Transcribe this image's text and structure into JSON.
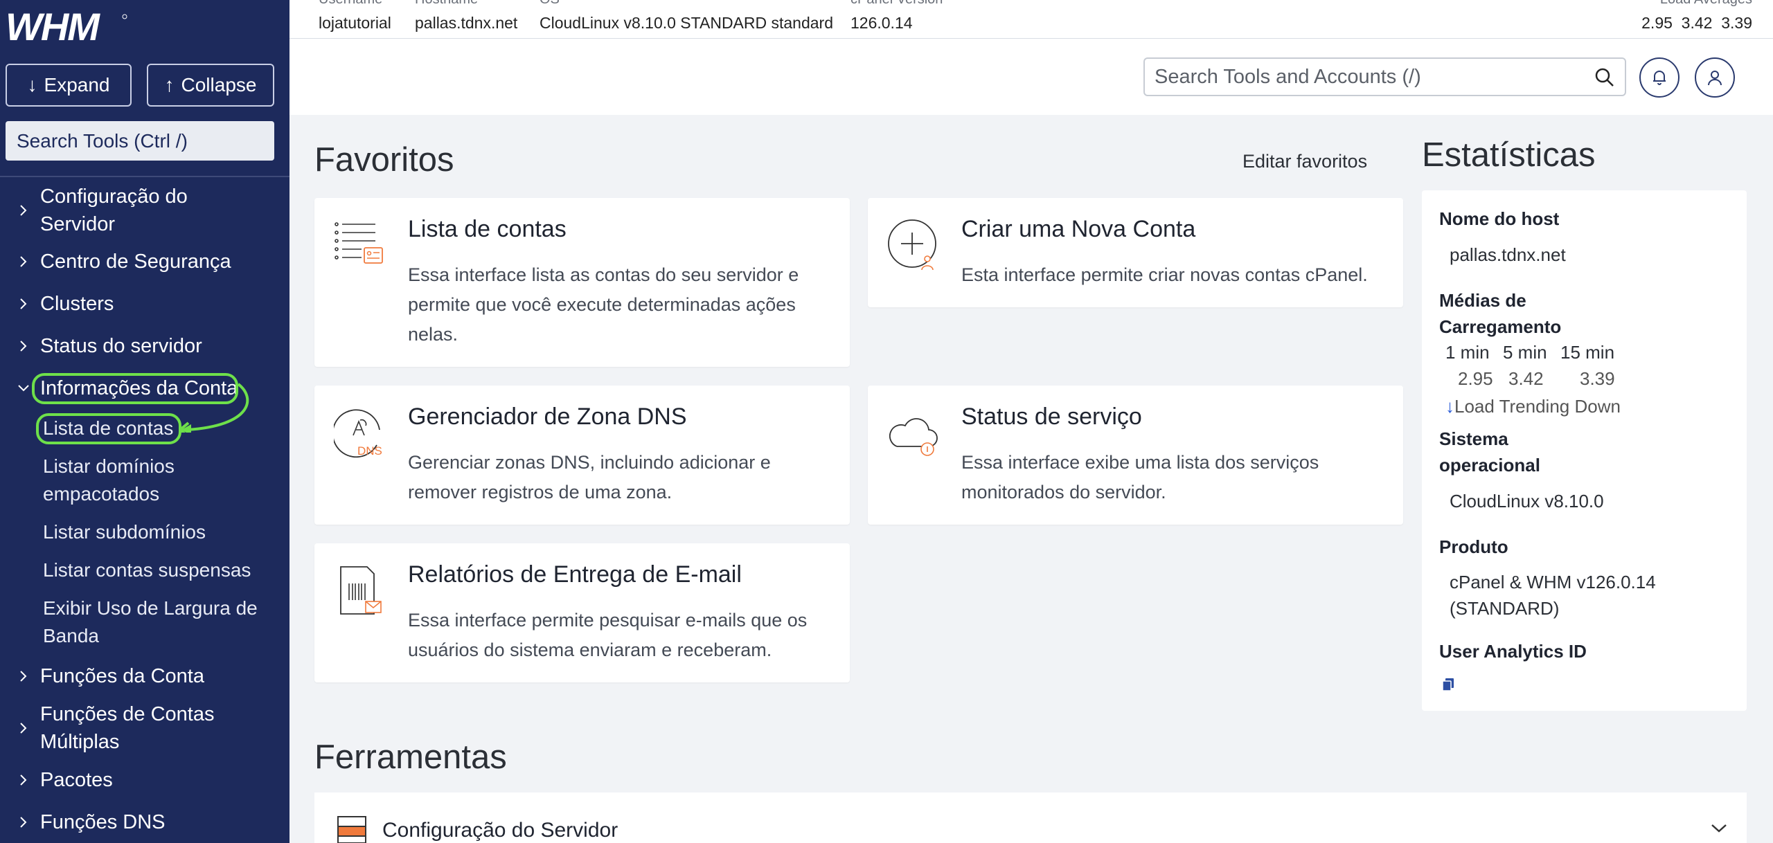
{
  "sidebar": {
    "logo": "WHM",
    "expand_label": "Expand",
    "collapse_label": "Collapse",
    "search_placeholder": "Search Tools (Ctrl /)",
    "items": [
      {
        "label": "Configuração do",
        "label2": "Servidor"
      },
      {
        "label": "Centro de Segurança"
      },
      {
        "label": "Clusters"
      },
      {
        "label": "Status do servidor"
      },
      {
        "label": "Informações da Conta"
      },
      {
        "label": "Funções da Conta"
      },
      {
        "label": "Funções de Contas",
        "label2": "Múltiplas"
      },
      {
        "label": "Pacotes"
      },
      {
        "label": "Funções DNS"
      }
    ],
    "subitems": [
      {
        "label": "Lista de contas"
      },
      {
        "label": "Listar domínios",
        "label2": "empacotados"
      },
      {
        "label": "Listar subdomínios"
      },
      {
        "label": "Listar contas suspensas"
      },
      {
        "label": "Exibir Uso de Largura de",
        "label2": "Banda"
      }
    ]
  },
  "topbar": {
    "username_head": "Username",
    "username": "lojatutorial",
    "hostname_head": "Hostname",
    "hostname": "pallas.tdnx.net",
    "os_head": "OS",
    "os": "CloudLinux v8.10.0 STANDARD standard",
    "cpanel_head": "cPanel Version",
    "cpanel": "126.0.14",
    "load_head": "Load Averages",
    "load": "2.95  3.42  3.39"
  },
  "header": {
    "search_placeholder": "Search Tools and Accounts (/)"
  },
  "favorites": {
    "title": "Favoritos",
    "edit_label": "Editar favoritos",
    "cards": [
      {
        "title": "Lista de contas",
        "desc": "Essa interface lista as contas do seu servidor e permite que você execute determinadas ações nelas."
      },
      {
        "title": "Criar uma Nova Conta",
        "desc": "Esta interface permite criar novas contas cPanel."
      },
      {
        "title": "Gerenciador de Zona DNS",
        "desc": "Gerenciar zonas DNS, incluindo adicionar e remover registros de uma zona."
      },
      {
        "title": "Status de serviço",
        "desc": "Essa interface exibe uma lista dos serviços monitorados do servidor."
      },
      {
        "title": "Relatórios de Entrega de E-mail",
        "desc": "Essa interface permite pesquisar e-mails que os usuários do sistema enviaram e receberam."
      }
    ],
    "dns_icon_text": "DNS"
  },
  "stats": {
    "title": "Estatísticas",
    "host_label": "Nome do host",
    "host_value": "pallas.tdnx.net",
    "load_label": "Médias de Carregamento",
    "load_cols": [
      "1 min",
      "5 min",
      "15 min"
    ],
    "load_vals": [
      "2.95",
      "3.42",
      "3.39"
    ],
    "trend": "Load Trending Down",
    "os_label": "Sistema operacional",
    "os_value": "CloudLinux v8.10.0",
    "product_label": "Produto",
    "product_value": "cPanel & WHM v126.0.14 (STANDARD)",
    "analytics_label": "User Analytics ID"
  },
  "tools": {
    "title": "Ferramentas",
    "section": "Configuração do Servidor"
  },
  "colors": {
    "sidebar": "#1d2a5c",
    "highlight": "#6ee04a",
    "accent": "#f07a3c"
  }
}
